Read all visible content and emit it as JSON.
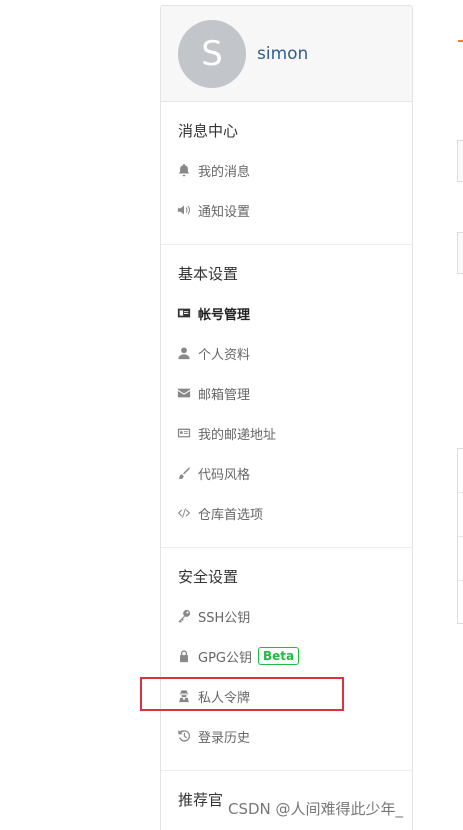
{
  "profile": {
    "avatar_letter": "S",
    "username": "simon"
  },
  "sections": [
    {
      "title": "消息中心",
      "items": [
        {
          "label": "我的消息",
          "icon": "bell-icon"
        },
        {
          "label": "通知设置",
          "icon": "volume-icon"
        }
      ]
    },
    {
      "title": "基本设置",
      "items": [
        {
          "label": "帐号管理",
          "icon": "id-card-icon",
          "active": true
        },
        {
          "label": "个人资料",
          "icon": "user-icon"
        },
        {
          "label": "邮箱管理",
          "icon": "envelope-icon"
        },
        {
          "label": "我的邮递地址",
          "icon": "address-card-icon"
        },
        {
          "label": "代码风格",
          "icon": "paint-brush-icon"
        },
        {
          "label": "仓库首选项",
          "icon": "code-icon"
        }
      ]
    },
    {
      "title": "安全设置",
      "items": [
        {
          "label": "SSH公钥",
          "icon": "key-icon"
        },
        {
          "label": "GPG公钥",
          "icon": "lock-icon",
          "badge": "Beta"
        },
        {
          "label": "私人令牌",
          "icon": "user-secret-icon",
          "highlighted": true
        },
        {
          "label": "登录历史",
          "icon": "history-icon"
        }
      ]
    },
    {
      "title": "推荐官",
      "items": []
    }
  ],
  "colors": {
    "highlight": "#d9333f",
    "beta": "#21ba45",
    "username": "#2f5f8f",
    "accent": "#f0812a"
  },
  "watermark": "CSDN @人间难得此少年_"
}
